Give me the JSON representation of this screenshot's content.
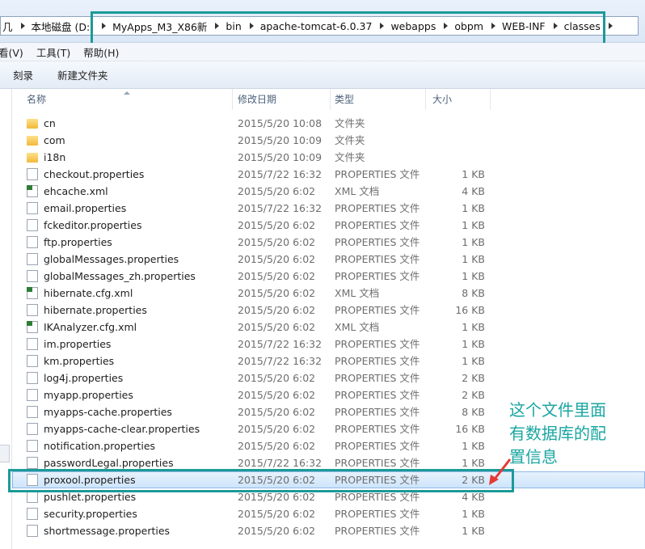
{
  "address": {
    "crumbs": [
      "几",
      "本地磁盘 (D:)",
      "MyApps_M3_X86新",
      "bin",
      "apache-tomcat-6.0.37",
      "webapps",
      "obpm",
      "WEB-INF",
      "classes"
    ]
  },
  "menu": {
    "view": "看(V)",
    "tools": "工具(T)",
    "help": "帮助(H)"
  },
  "toolbar": {
    "burn": "刻录",
    "new_folder": "新建文件夹"
  },
  "columns": {
    "name": "名称",
    "date": "修改日期",
    "type": "类型",
    "size": "大小"
  },
  "files": [
    {
      "name": "cn",
      "date": "2015/5/20 10:08",
      "type": "文件夹",
      "size": "",
      "kind": "folder"
    },
    {
      "name": "com",
      "date": "2015/5/20 10:09",
      "type": "文件夹",
      "size": "",
      "kind": "folder"
    },
    {
      "name": "i18n",
      "date": "2015/5/20 10:09",
      "type": "文件夹",
      "size": "",
      "kind": "folder"
    },
    {
      "name": "checkout.properties",
      "date": "2015/7/22 16:32",
      "type": "PROPERTIES 文件",
      "size": "1 KB",
      "kind": "doc"
    },
    {
      "name": "ehcache.xml",
      "date": "2015/5/20 6:02",
      "type": "XML 文档",
      "size": "4 KB",
      "kind": "xml"
    },
    {
      "name": "email.properties",
      "date": "2015/7/22 16:32",
      "type": "PROPERTIES 文件",
      "size": "1 KB",
      "kind": "doc"
    },
    {
      "name": "fckeditor.properties",
      "date": "2015/5/20 6:02",
      "type": "PROPERTIES 文件",
      "size": "1 KB",
      "kind": "doc"
    },
    {
      "name": "ftp.properties",
      "date": "2015/5/20 6:02",
      "type": "PROPERTIES 文件",
      "size": "1 KB",
      "kind": "doc"
    },
    {
      "name": "globalMessages.properties",
      "date": "2015/5/20 6:02",
      "type": "PROPERTIES 文件",
      "size": "1 KB",
      "kind": "doc"
    },
    {
      "name": "globalMessages_zh.properties",
      "date": "2015/5/20 6:02",
      "type": "PROPERTIES 文件",
      "size": "1 KB",
      "kind": "doc"
    },
    {
      "name": "hibernate.cfg.xml",
      "date": "2015/5/20 6:02",
      "type": "XML 文档",
      "size": "8 KB",
      "kind": "xml"
    },
    {
      "name": "hibernate.properties",
      "date": "2015/5/20 6:02",
      "type": "PROPERTIES 文件",
      "size": "16 KB",
      "kind": "doc"
    },
    {
      "name": "IKAnalyzer.cfg.xml",
      "date": "2015/5/20 6:02",
      "type": "XML 文档",
      "size": "1 KB",
      "kind": "xml"
    },
    {
      "name": "im.properties",
      "date": "2015/7/22 16:32",
      "type": "PROPERTIES 文件",
      "size": "1 KB",
      "kind": "doc"
    },
    {
      "name": "km.properties",
      "date": "2015/7/22 16:32",
      "type": "PROPERTIES 文件",
      "size": "1 KB",
      "kind": "doc"
    },
    {
      "name": "log4j.properties",
      "date": "2015/5/20 6:02",
      "type": "PROPERTIES 文件",
      "size": "2 KB",
      "kind": "doc"
    },
    {
      "name": "myapp.properties",
      "date": "2015/5/20 6:02",
      "type": "PROPERTIES 文件",
      "size": "2 KB",
      "kind": "doc"
    },
    {
      "name": "myapps-cache.properties",
      "date": "2015/5/20 6:02",
      "type": "PROPERTIES 文件",
      "size": "8 KB",
      "kind": "doc"
    },
    {
      "name": "myapps-cache-clear.properties",
      "date": "2015/5/20 6:02",
      "type": "PROPERTIES 文件",
      "size": "16 KB",
      "kind": "doc"
    },
    {
      "name": "notification.properties",
      "date": "2015/5/20 6:02",
      "type": "PROPERTIES 文件",
      "size": "1 KB",
      "kind": "doc"
    },
    {
      "name": "passwordLegal.properties",
      "date": "2015/7/22 16:32",
      "type": "PROPERTIES 文件",
      "size": "1 KB",
      "kind": "doc"
    },
    {
      "name": "proxool.properties",
      "date": "2015/5/20 6:02",
      "type": "PROPERTIES 文件",
      "size": "2 KB",
      "kind": "doc",
      "selected": true
    },
    {
      "name": "pushlet.properties",
      "date": "2015/5/20 6:02",
      "type": "PROPERTIES 文件",
      "size": "4 KB",
      "kind": "doc"
    },
    {
      "name": "security.properties",
      "date": "2015/5/20 6:02",
      "type": "PROPERTIES 文件",
      "size": "1 KB",
      "kind": "doc"
    },
    {
      "name": "shortmessage.properties",
      "date": "2015/5/20 6:02",
      "type": "PROPERTIES 文件",
      "size": "1 KB",
      "kind": "doc"
    }
  ],
  "annotation": {
    "lines": [
      "这个文件里面",
      "有数据库的配",
      "置信息"
    ],
    "box_color": "#1b9a97",
    "text_color": "#1aa6a1",
    "arrow_color": "#e53935"
  }
}
